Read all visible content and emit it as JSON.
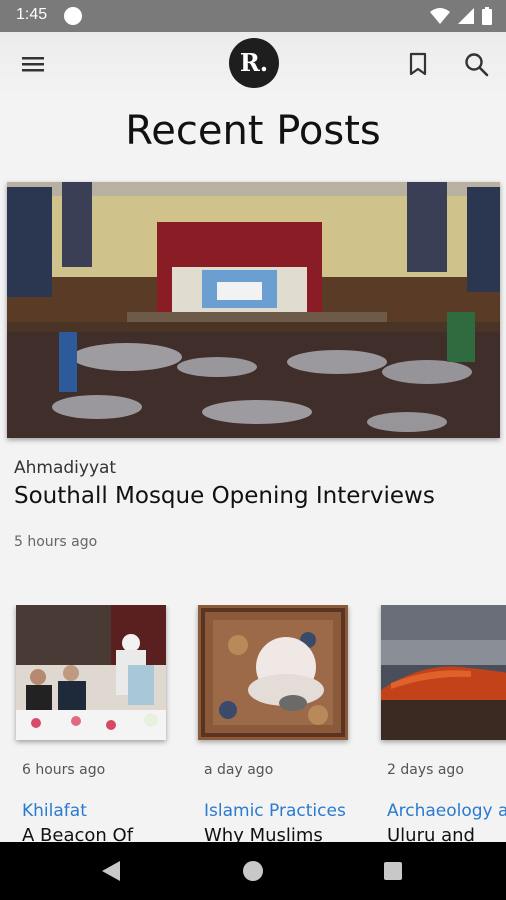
{
  "status_bar": {
    "time": "1:45",
    "icons": [
      "wifi-icon",
      "signal-icon",
      "battery-icon"
    ]
  },
  "app_bar": {
    "logo": "R.",
    "icons": [
      "menu-icon",
      "bookmark-icon",
      "search-icon"
    ]
  },
  "page": {
    "title": "Recent Posts"
  },
  "featured": {
    "category": "Ahmadiyyat",
    "title": "Southall Mosque Opening Interviews",
    "time": "5 hours ago"
  },
  "posts": [
    {
      "time": "6 hours ago",
      "category": "Khilafat",
      "title": "A Beacon Of"
    },
    {
      "time": "a day ago",
      "category": "Islamic Practices",
      "title": "Why Muslims"
    },
    {
      "time": "2 days ago",
      "category": "Archaeology and",
      "title": "Uluru and"
    }
  ],
  "colors": {
    "accent_link": "#2a7bd0",
    "status_bar": "#7a7a7a",
    "nav_bar": "#000000"
  }
}
